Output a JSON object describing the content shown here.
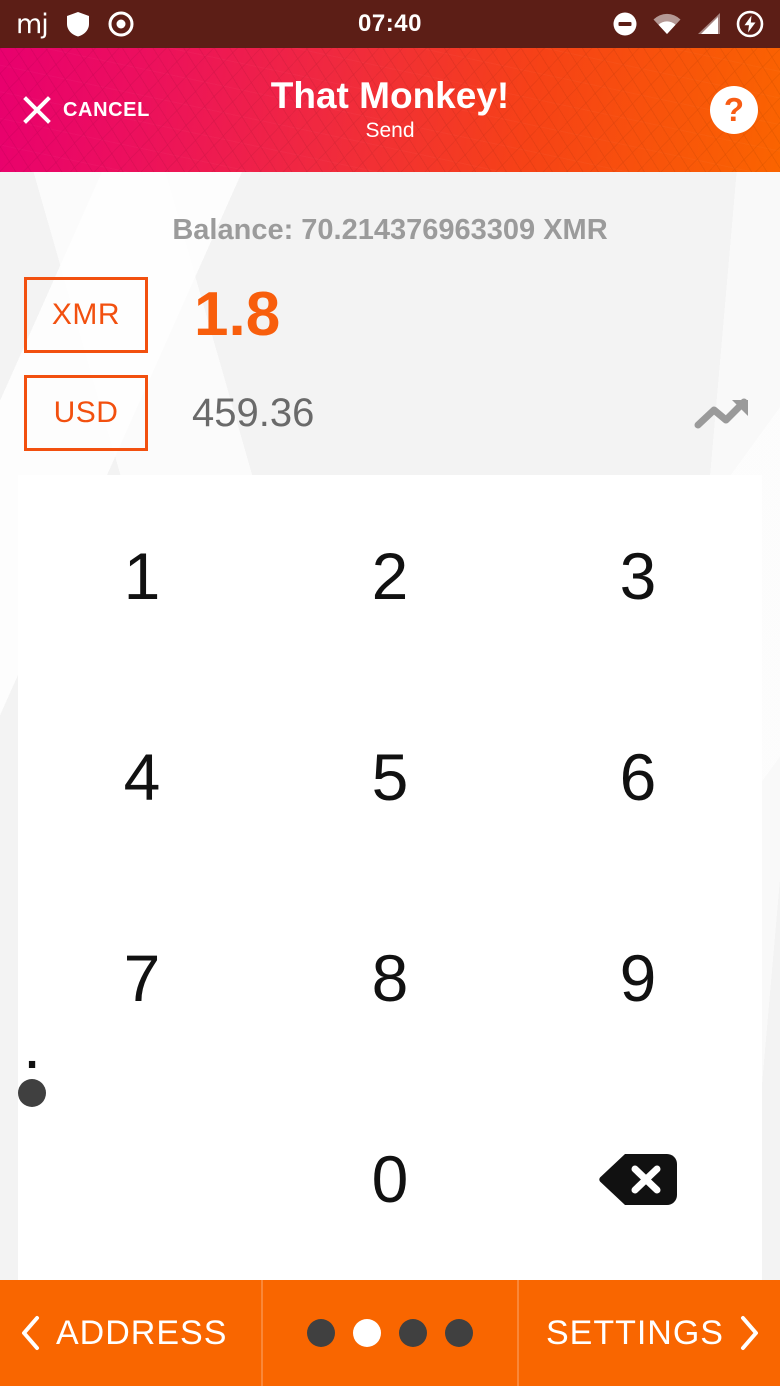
{
  "statusbar": {
    "clock": "07:40",
    "logo_text": "mj",
    "left_icons": [
      "shield-icon",
      "target-icon"
    ],
    "right_icons": [
      "do-not-disturb-icon",
      "wifi-icon",
      "cell-signal-icon",
      "charging-bolt-icon"
    ],
    "background_color": "#5C1E16"
  },
  "header": {
    "cancel_label": "CANCEL",
    "title": "That Monkey!",
    "subtitle": "Send",
    "help_label": "?",
    "gradient_start": "#E8006E",
    "gradient_end": "#FA6400"
  },
  "balance": {
    "text": "Balance: 70.214376963309 XMR",
    "amount": "70.214376963309",
    "currency": "XMR"
  },
  "amount_entry": {
    "primary": {
      "currency": "XMR",
      "value": "1.8",
      "color": "#F85E0C"
    },
    "secondary": {
      "currency": "USD",
      "value": "459.36",
      "color": "#6A6A6A"
    },
    "trend_icon": "trending-up-icon"
  },
  "keypad": {
    "keys": [
      {
        "label": "1",
        "name": "key-1"
      },
      {
        "label": "2",
        "name": "key-2"
      },
      {
        "label": "3",
        "name": "key-3"
      },
      {
        "label": "4",
        "name": "key-4"
      },
      {
        "label": "5",
        "name": "key-5"
      },
      {
        "label": "6",
        "name": "key-6"
      },
      {
        "label": "7",
        "name": "key-7"
      },
      {
        "label": "8",
        "name": "key-8"
      },
      {
        "label": "9",
        "name": "key-9"
      },
      {
        "label": ".",
        "name": "key-decimal"
      },
      {
        "label": "0",
        "name": "key-0"
      },
      {
        "label": "",
        "name": "key-backspace"
      }
    ]
  },
  "bottombar": {
    "left_label": "ADDRESS",
    "right_label": "SETTINGS",
    "background_color": "#F96600",
    "page_dots": {
      "count": 4,
      "active_index": 1
    }
  }
}
